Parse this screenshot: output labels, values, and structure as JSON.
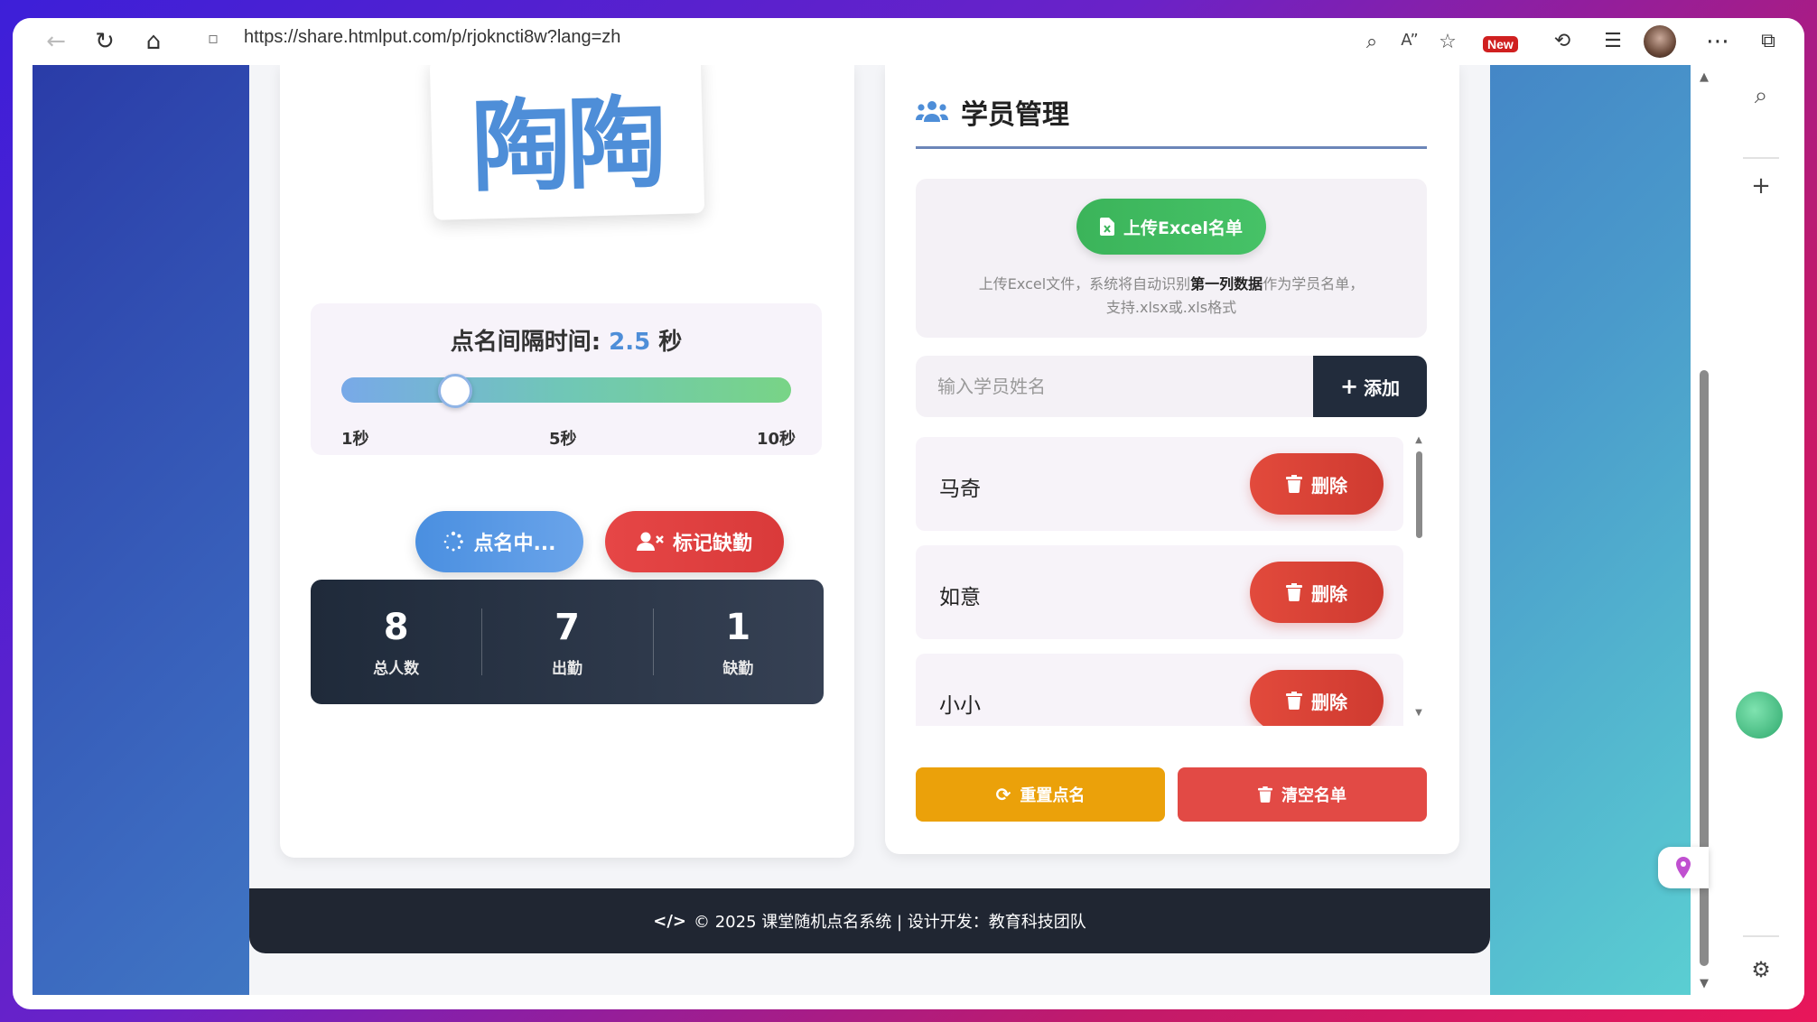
{
  "browser": {
    "url": "https://share.htmlput.com/p/rjokncti8w?lang=zh",
    "new_badge": "New"
  },
  "name_display": {
    "name": "陶陶"
  },
  "interval": {
    "label": "点名间隔时间:",
    "value": "2.5",
    "unit": "秒",
    "min_label": "1秒",
    "mid_label": "5秒",
    "max_label": "10秒",
    "slider_value": 2.5,
    "slider_min": 1,
    "slider_max": 10
  },
  "actions": {
    "calling_label": "点名中...",
    "mark_absent_label": "标记缺勤"
  },
  "stats": [
    {
      "value": "8",
      "label": "总人数"
    },
    {
      "value": "7",
      "label": "出勤"
    },
    {
      "value": "1",
      "label": "缺勤"
    }
  ],
  "management": {
    "title": "学员管理",
    "upload_label": "上传Excel名单",
    "hint_prefix": "上传Excel文件，系统将自动识别",
    "hint_bold": "第一列数据",
    "hint_suffix": "作为学员名单，",
    "hint_line2": "支持.xlsx或.xls格式",
    "input_placeholder": "输入学员姓名",
    "add_label": "添加",
    "delete_label": "删除",
    "students": [
      {
        "name": "马奇"
      },
      {
        "name": "如意"
      },
      {
        "name": "小小"
      }
    ],
    "reset_label": "重置点名",
    "clear_label": "清空名单"
  },
  "footer": {
    "text": "© 2025 课堂随机点名系统 | 设计开发：教育科技团队"
  },
  "colors": {
    "accent_blue": "#4e8ed8",
    "delete_red": "#e24a3c",
    "upload_green": "#3bb45a",
    "reset_orange": "#eba10a",
    "dark": "#222c3c"
  }
}
